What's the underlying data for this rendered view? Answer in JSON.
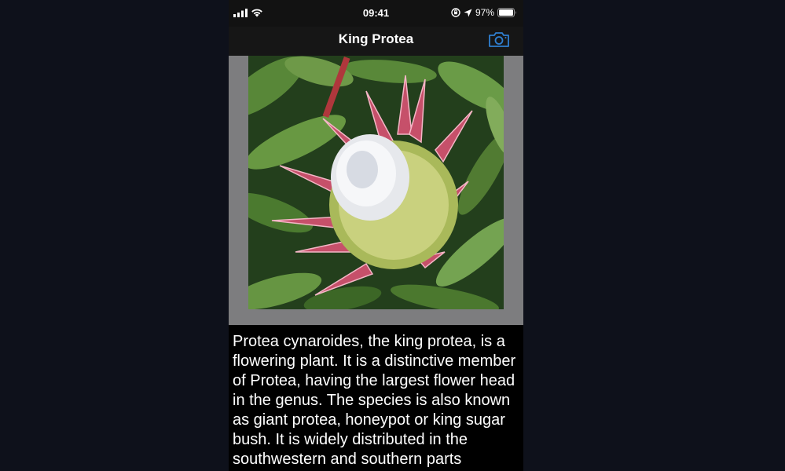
{
  "status_bar": {
    "time": "09:41",
    "battery_percent": "97%",
    "icons": [
      "signal-icon",
      "wifi-icon",
      "orientation-lock-icon",
      "location-arrow-icon",
      "battery-icon"
    ]
  },
  "nav": {
    "title": "King Protea",
    "right_button_icon": "camera-icon",
    "accent_color": "#2f7fd0"
  },
  "content": {
    "image_alt": "King protea flower",
    "description": "Protea cynaroides, the king protea, is a flowering plant. It is a distinctive member of Protea, having the largest flower head in the genus. The species is also known as giant protea, honeypot or king sugar bush. It is widely distributed in the southwestern and southern parts"
  }
}
